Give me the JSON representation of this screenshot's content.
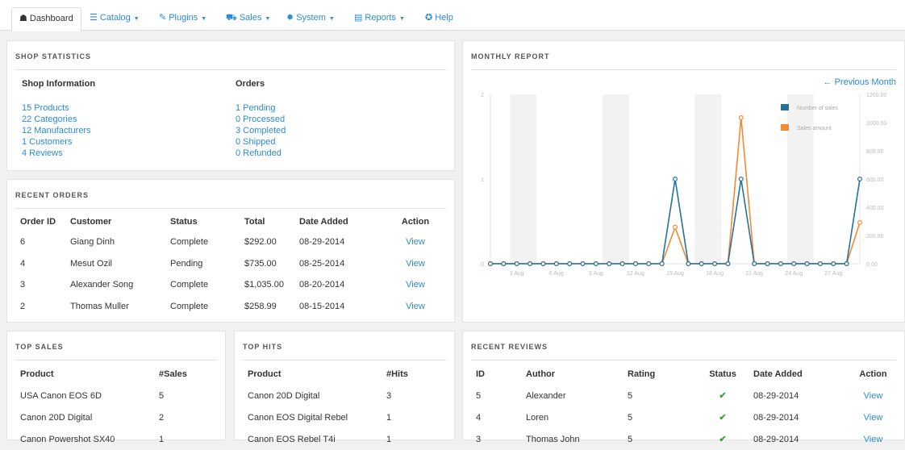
{
  "nav": {
    "tabs": [
      {
        "label": "Dashboard",
        "icon": "home-icon",
        "glyph": "☗",
        "caret": false,
        "active": true
      },
      {
        "label": "Catalog",
        "icon": "list-icon",
        "glyph": "☰",
        "caret": true,
        "active": false
      },
      {
        "label": "Plugins",
        "icon": "wrench-icon",
        "glyph": "✎",
        "caret": true,
        "active": false
      },
      {
        "label": "Sales",
        "icon": "cart-icon",
        "glyph": "⛟",
        "caret": true,
        "active": false
      },
      {
        "label": "System",
        "icon": "gear-icon",
        "glyph": "✹",
        "caret": true,
        "active": false
      },
      {
        "label": "Reports",
        "icon": "calendar-icon",
        "glyph": "▤",
        "caret": true,
        "active": false
      },
      {
        "label": "Help",
        "icon": "lifebuoy-icon",
        "glyph": "✪",
        "caret": false,
        "active": false
      }
    ]
  },
  "shop_stats": {
    "title": "SHOP STATISTICS",
    "info_heading": "Shop Information",
    "info_items": [
      "15 Products",
      "22 Categories",
      "12 Manufacturers",
      "1 Customers",
      "4 Reviews"
    ],
    "orders_heading": "Orders",
    "orders_items": [
      "1 Pending",
      "0 Processed",
      "3 Completed",
      "0 Shipped",
      "0 Refunded"
    ]
  },
  "recent_orders": {
    "title": "RECENT ORDERS",
    "columns": [
      "Order ID",
      "Customer",
      "Status",
      "Total",
      "Date Added",
      "Action"
    ],
    "rows": [
      [
        "6",
        "Giang Dinh",
        "Complete",
        "$292.00",
        "08-29-2014",
        "View"
      ],
      [
        "4",
        "Mesut Ozil",
        "Pending",
        "$735.00",
        "08-25-2014",
        "View"
      ],
      [
        "3",
        "Alexander Song",
        "Complete",
        "$1,035.00",
        "08-20-2014",
        "View"
      ],
      [
        "2",
        "Thomas Muller",
        "Complete",
        "$258.99",
        "08-15-2014",
        "View"
      ]
    ]
  },
  "monthly_report": {
    "title": "MONTHLY REPORT",
    "prev_link": "← Previous Month"
  },
  "chart_data": {
    "type": "line",
    "title": "",
    "x": [
      1,
      2,
      3,
      4,
      5,
      6,
      7,
      8,
      9,
      10,
      11,
      12,
      13,
      14,
      15,
      16,
      17,
      18,
      19,
      20,
      21,
      22,
      23,
      24,
      25,
      26,
      27,
      28,
      29
    ],
    "x_tick_labels": [
      "3 Aug",
      "6 Aug",
      "9 Aug",
      "12 Aug",
      "15 Aug",
      "18 Aug",
      "21 Aug",
      "24 Aug",
      "27 Aug"
    ],
    "x_tick_values": [
      3,
      6,
      9,
      12,
      15,
      18,
      21,
      24,
      27
    ],
    "y_left_ticks": [
      "0",
      "1",
      "2"
    ],
    "y_left_range": [
      0,
      2
    ],
    "y_right_ticks": [
      "0.00",
      "200.00",
      "400.00",
      "600.00",
      "800.00",
      "1000.00",
      "1200.00"
    ],
    "y_right_range": [
      0,
      1200
    ],
    "series": [
      {
        "name": "Number of sales",
        "color": "#27719d",
        "axis": "left",
        "values": [
          0,
          0,
          0,
          0,
          0,
          0,
          0,
          0,
          0,
          0,
          0,
          0,
          0,
          0,
          1,
          0,
          0,
          0,
          0,
          1,
          0,
          0,
          0,
          0,
          0,
          0,
          0,
          0,
          1
        ]
      },
      {
        "name": "Sales amount",
        "color": "#f28a35",
        "axis": "right",
        "values": [
          0,
          0,
          0,
          0,
          0,
          0,
          0,
          0,
          0,
          0,
          0,
          0,
          0,
          0,
          258.99,
          0,
          0,
          0,
          0,
          1035,
          0,
          0,
          0,
          0,
          0,
          0,
          0,
          0,
          292
        ]
      }
    ],
    "legend_position": "top-right",
    "grid": false
  },
  "top_sales": {
    "title": "TOP SALES",
    "columns": [
      "Product",
      "#Sales"
    ],
    "rows": [
      [
        "USA Canon EOS 6D",
        "5"
      ],
      [
        "Canon 20D Digital",
        "2"
      ],
      [
        "Canon Powershot SX40",
        "1"
      ]
    ]
  },
  "top_hits": {
    "title": "TOP HITS",
    "columns": [
      "Product",
      "#Hits"
    ],
    "rows": [
      [
        "Canon 20D Digital",
        "3"
      ],
      [
        "Canon EOS Digital Rebel",
        "1"
      ],
      [
        "Canon EOS Rebel T4i",
        "1"
      ]
    ]
  },
  "recent_reviews": {
    "title": "RECENT REVIEWS",
    "columns": [
      "ID",
      "Author",
      "Rating",
      "Status",
      "Date Added",
      "Action"
    ],
    "rows": [
      [
        "5",
        "Alexander",
        "5",
        "✔",
        "08-29-2014",
        "View"
      ],
      [
        "4",
        "Loren",
        "5",
        "✔",
        "08-29-2014",
        "View"
      ],
      [
        "3",
        "Thomas John",
        "5",
        "✔",
        "08-29-2014",
        "View"
      ]
    ]
  }
}
